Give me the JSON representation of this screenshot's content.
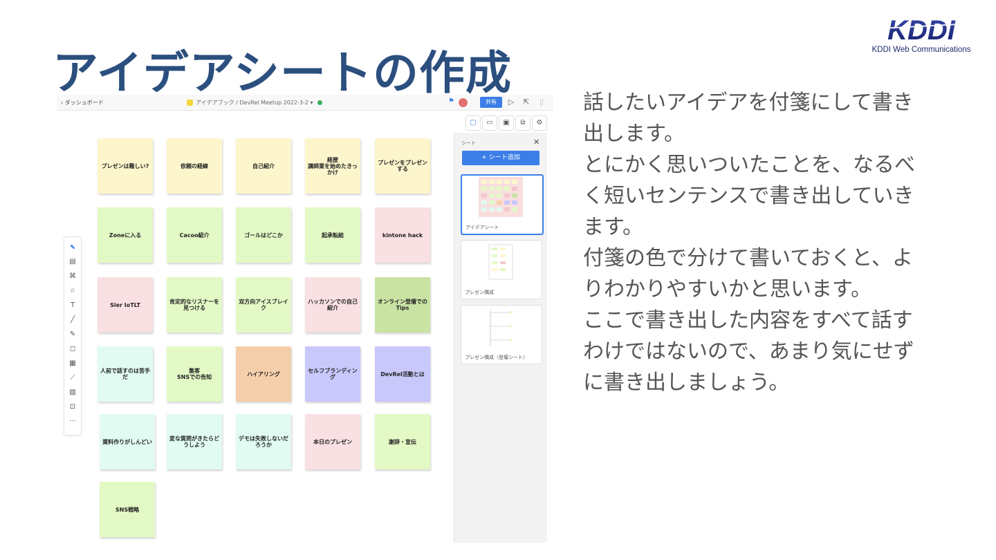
{
  "slide": {
    "title": "アイデアシートの作成",
    "logo_text": "KDDI",
    "logo_subtext": "KDDI Web Communications",
    "body": [
      "話したいアイデアを付箋にして書き出します。",
      "とにかく思いついたことを、なるべく短いセンテンスで書き出していきます。",
      "付箋の色で分けて書いておくと、よりわかりやすいかと思います。",
      "ここで書き出した内容をすべて話すわけではないので、あまり気にせずに書き出しましょう。"
    ]
  },
  "app": {
    "back_label": "‹ ダッシュボード",
    "doc_title": "アイデアブック / DevRel Meetup 2022-3-2 ▾",
    "share_label": "共有",
    "colors": {
      "accent": "#3c7ee8",
      "yellow": "#fdf6cd",
      "green": "#e3f9c5",
      "pink": "#f9e0e3",
      "dark_green": "#c9e3a3",
      "mint": "#e1fbf3",
      "orange": "#f5cfab",
      "purple": "#c9c8fb"
    },
    "notes": [
      {
        "text": "プレゼンは難しい?",
        "color": "yellow"
      },
      {
        "text": "依頼の経緯",
        "color": "yellow"
      },
      {
        "text": "自己紹介",
        "color": "yellow"
      },
      {
        "text": "経歴\n講師業を始めたきっかけ",
        "color": "yellow"
      },
      {
        "text": "プレゼンをプレゼンする",
        "color": "yellow"
      },
      {
        "text": "Zoneに入る",
        "color": "green"
      },
      {
        "text": "Cacoo紹介",
        "color": "green"
      },
      {
        "text": "ゴールはどこか",
        "color": "green"
      },
      {
        "text": "起承転結",
        "color": "green"
      },
      {
        "text": "kintone hack",
        "color": "pink"
      },
      {
        "text": "Sler IoTLT",
        "color": "pink"
      },
      {
        "text": "肯定的なリスナーを見つける",
        "color": "green"
      },
      {
        "text": "双方向アイスブレイク",
        "color": "green"
      },
      {
        "text": "ハッカソンでの自己紹介",
        "color": "pink"
      },
      {
        "text": "オンライン登壇でのTips",
        "color": "dark_green"
      },
      {
        "text": "人前で話すのは苦手だ",
        "color": "mint"
      },
      {
        "text": "集客\nSNSでの告知",
        "color": "green"
      },
      {
        "text": "ハイアリング",
        "color": "orange"
      },
      {
        "text": "セルフブランディング",
        "color": "purple"
      },
      {
        "text": "DevRel活動とは",
        "color": "purple"
      },
      {
        "text": "資料作りがしんどい",
        "color": "mint"
      },
      {
        "text": "変な質問がきたらどうしよう",
        "color": "mint"
      },
      {
        "text": "デモは失敗しないだろうか",
        "color": "mint"
      },
      {
        "text": "本日のプレゼン",
        "color": "pink"
      },
      {
        "text": "謝辞・宣伝",
        "color": "green"
      },
      {
        "text": "SNS戦略",
        "color": "green"
      }
    ],
    "panel": {
      "title": "シート",
      "add_label": "+ シート追加",
      "sheets": [
        "アイデアシート",
        "プレゼン構成",
        "プレゼン構成（登壇シート）"
      ]
    },
    "icons": {
      "left_toolbar": [
        "select-icon",
        "sheet-icon",
        "shape-icon",
        "star-icon",
        "text-icon",
        "line-icon",
        "pen-icon",
        "sticky-note-icon",
        "table-icon",
        "chart-icon",
        "image-icon",
        "embed-icon",
        "more-icon"
      ],
      "right_tools": [
        "sheets-icon",
        "comment-icon",
        "video-icon",
        "share-screen-icon",
        "settings-icon"
      ]
    }
  }
}
